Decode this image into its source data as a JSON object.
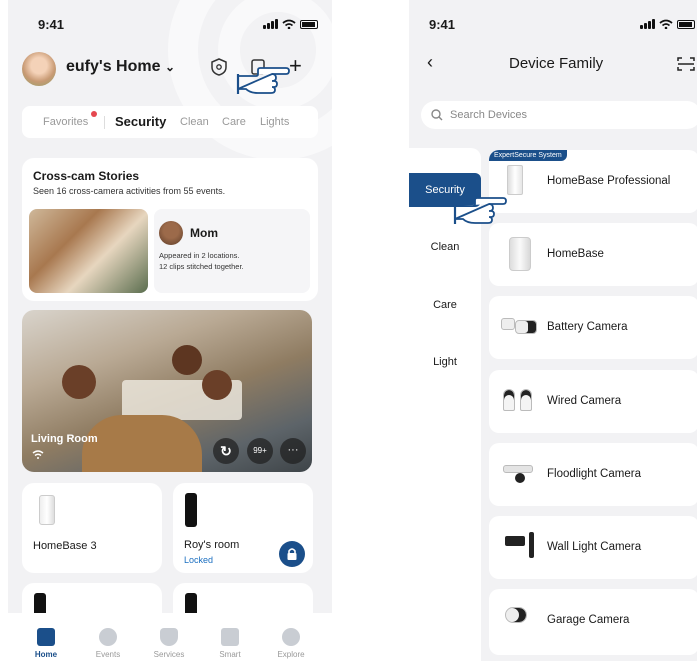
{
  "left": {
    "status_time": "9:41",
    "home_name": "eufy's Home",
    "tabs": [
      "Favorites",
      "Security",
      "Clean",
      "Care",
      "Lights"
    ],
    "stories": {
      "title": "Cross-cam Stories",
      "subtitle": "Seen 16 cross-camera activities from 55 events.",
      "person": "Mom",
      "line1": "Appeared in 2 locations.",
      "line2": "12 clips stitched together."
    },
    "camera": {
      "room": "Living Room",
      "badge": "99+",
      "more": "···"
    },
    "devices": [
      {
        "name": "HomeBase 3"
      },
      {
        "name": "Roy's room",
        "status": "Locked"
      }
    ],
    "nav": [
      "Home",
      "Events",
      "Services",
      "Smart",
      "Explore"
    ],
    "colors": {
      "accent": "#1b4f8a",
      "badge": "#e5474f"
    }
  },
  "right": {
    "status_time": "9:41",
    "title": "Device Family",
    "search_placeholder": "Search Devices",
    "categories": [
      "Security",
      "Clean",
      "Care",
      "Light"
    ],
    "badge": "ExpertSecure System",
    "devices": [
      "HomeBase Professional",
      "HomeBase",
      "Battery Camera",
      "Wired Camera",
      "Floodlight Camera",
      "Wall Light Camera",
      "Garage Camera"
    ]
  }
}
